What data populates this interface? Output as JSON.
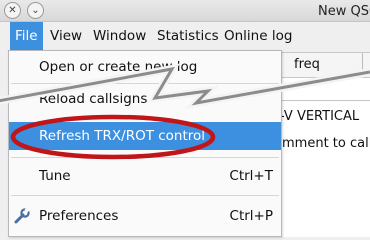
{
  "window": {
    "title": "New QSO"
  },
  "menubar": {
    "items": [
      {
        "label": "File"
      },
      {
        "label": "View"
      },
      {
        "label": "Window"
      },
      {
        "label": "Statistics"
      },
      {
        "label": "Online log"
      }
    ]
  },
  "table": {
    "header_col": "freq",
    "rows": [
      "-V VERTICAL",
      "mment to calls"
    ]
  },
  "file_menu": {
    "items": [
      {
        "label": "Open or create new log",
        "shortcut": ""
      },
      {
        "label": "Reload callsigns",
        "shortcut": ""
      },
      {
        "label": "Refresh TRX/ROT control",
        "shortcut": ""
      },
      {
        "label": "Tune",
        "shortcut": "Ctrl+T"
      },
      {
        "label": "Preferences",
        "shortcut": "Ctrl+P"
      }
    ]
  },
  "annotations": {
    "highlight_color": "#c0161a",
    "zigzag_color": "#8c8c8c"
  }
}
